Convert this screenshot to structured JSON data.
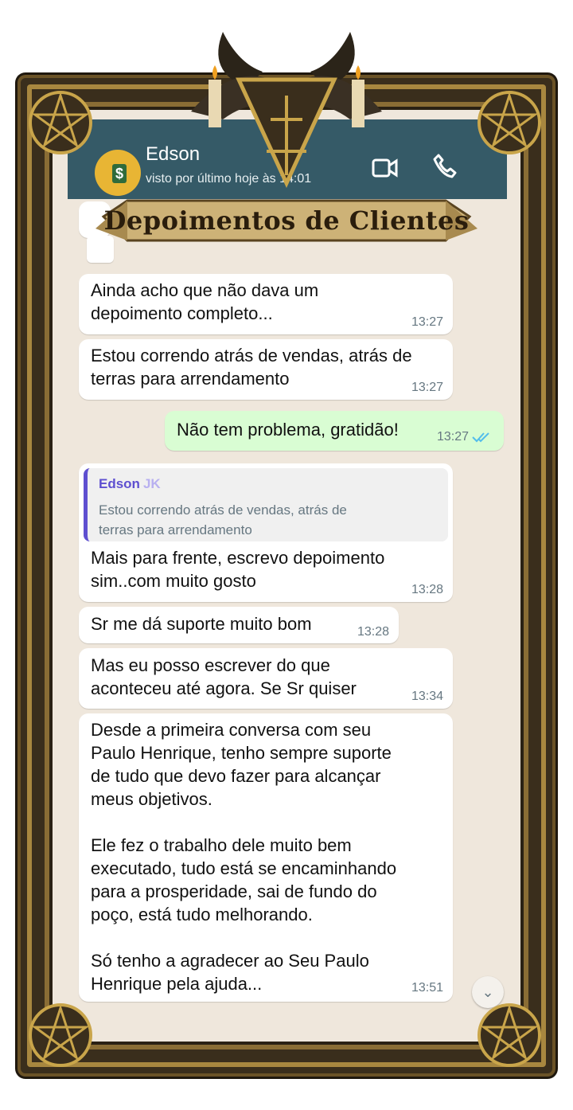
{
  "header": {
    "name": "Edson",
    "status": "visto por último hoje às 14:01"
  },
  "banner": {
    "title": "Depoimentos de Clientes"
  },
  "messages": [
    {
      "text": "Ainda acho que não dava um\ndepoimento completo...",
      "time": "13:27"
    },
    {
      "text": "Estou correndo atrás de vendas, atrás de\nterras para arrendamento",
      "time": "13:27"
    },
    {
      "text": "Não tem problema, gratidão!",
      "time": "13:27"
    },
    {
      "quote_name": "Edson",
      "quote_emoji": "JK",
      "quote_text": "Estou correndo atrás de vendas, atrás de\nterras para arrendamento",
      "text": "Mais para frente, escrevo depoimento\nsim..com muito gosto",
      "time": "13:28"
    },
    {
      "text": "Sr me dá suporte muito bom",
      "time": "13:28"
    },
    {
      "text": "Mas eu posso escrever do que\naconteceu até agora. Se Sr quiser",
      "time": "13:34"
    },
    {
      "text": "Desde a primeira conversa com seu\nPaulo Henrique, tenho sempre suporte\nde tudo que devo fazer para alcançar\nmeus objetivos.\n\nEle fez o trabalho dele muito bem\nexecutado, tudo está se encaminhando\npara a prosperidade, sai de fundo do\npoço, está tudo melhorando.\n\nSó tenho a agradecer ao Seu Paulo\nHenrique pela ajuda...",
      "time": "13:51"
    }
  ],
  "colors": {
    "header": "#355a67",
    "outgoing": "#d9fdd3",
    "quote_accent": "#5e4fd0",
    "read_ticks": "#53bdeb"
  }
}
